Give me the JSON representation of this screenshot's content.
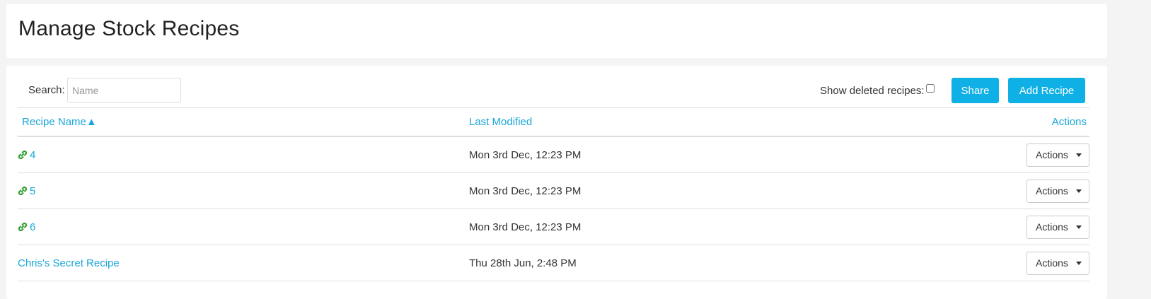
{
  "page": {
    "title": "Manage Stock Recipes"
  },
  "toolbar": {
    "search_label": "Search:",
    "search_placeholder": "Name",
    "search_value": "",
    "show_deleted_label": "Show deleted recipes:",
    "show_deleted_checked": false,
    "share_label": "Share",
    "add_label": "Add Recipe"
  },
  "table": {
    "headers": {
      "name": "Recipe Name▲",
      "modified": "Last Modified",
      "actions": "Actions"
    },
    "rows": [
      {
        "name": "4",
        "linked": true,
        "modified": "Mon 3rd Dec, 12:23 PM",
        "action_label": "Actions"
      },
      {
        "name": "5",
        "linked": true,
        "modified": "Mon 3rd Dec, 12:23 PM",
        "action_label": "Actions"
      },
      {
        "name": "6",
        "linked": true,
        "modified": "Mon 3rd Dec, 12:23 PM",
        "action_label": "Actions"
      },
      {
        "name": "Chris's Secret Recipe",
        "linked": false,
        "modified": "Thu 28th Jun, 2:48 PM",
        "action_label": "Actions"
      }
    ]
  },
  "colors": {
    "accent": "#0eb0e6",
    "link": "#1aa7d8",
    "link_icon": "#2e9e2e"
  },
  "icons": {
    "linked": "link-icon",
    "dropdown": "caret-down-icon"
  }
}
